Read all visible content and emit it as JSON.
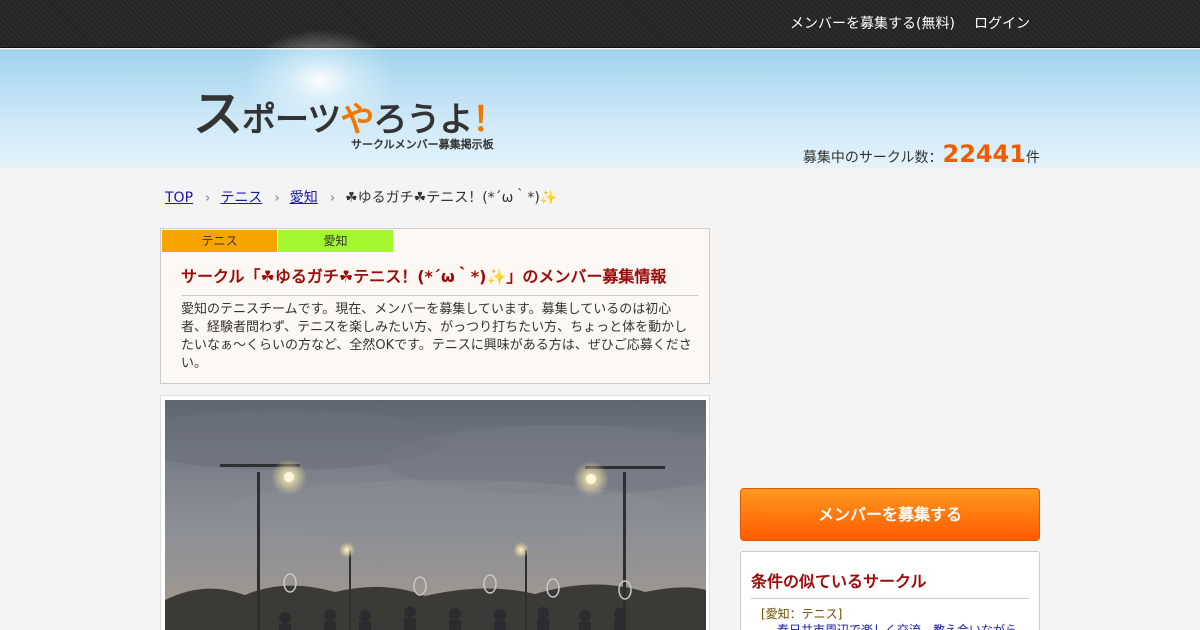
{
  "topnav": {
    "recruit_label": "メンバーを募集する(無料)",
    "login_label": "ログイン"
  },
  "header": {
    "logo_part1": "ス",
    "logo_part2": "ポーツ",
    "logo_part3": "や",
    "logo_part4": "ろうよ",
    "logo_part5": "！",
    "logo_sub": "サークルメンバー募集掲示板",
    "count_label": "募集中のサークル数：",
    "count_value": "22441",
    "count_unit": "件"
  },
  "breadcrumb": {
    "items": [
      "TOP",
      "テニス",
      "愛知"
    ],
    "current": "☘ゆるガチ☘テニス！(*´ω｀*)✨"
  },
  "circle": {
    "tags": [
      "テニス",
      "愛知"
    ],
    "title": "サークル「☘ゆるガチ☘テニス！(*´ω｀*)✨」のメンバー募集情報",
    "description": "愛知のテニスチームです。現在、メンバーを募集しています。募集しているのは初心者、経験者問わず、テニスを楽しみたい方、がっつり打ちたい方、ちょっと体を動かしたいなぁ～くらいの方など、全然OKです。テニスに興味がある方は、ぜひご応募ください。"
  },
  "sidebar": {
    "recruit_button": "メンバーを募集する",
    "similar_title": "条件の似ているサークル",
    "similar_category": "[愛知：テニス]",
    "similar_link": "春日井市周辺で楽しく交流、教え合いながら"
  },
  "colors": {
    "accent_orange": "#ff7a00",
    "title_red": "#9c0a0a",
    "tag_sport": "#f7a400",
    "tag_area": "#a3f72e"
  },
  "icons": [
    "chevron-right-icon"
  ]
}
